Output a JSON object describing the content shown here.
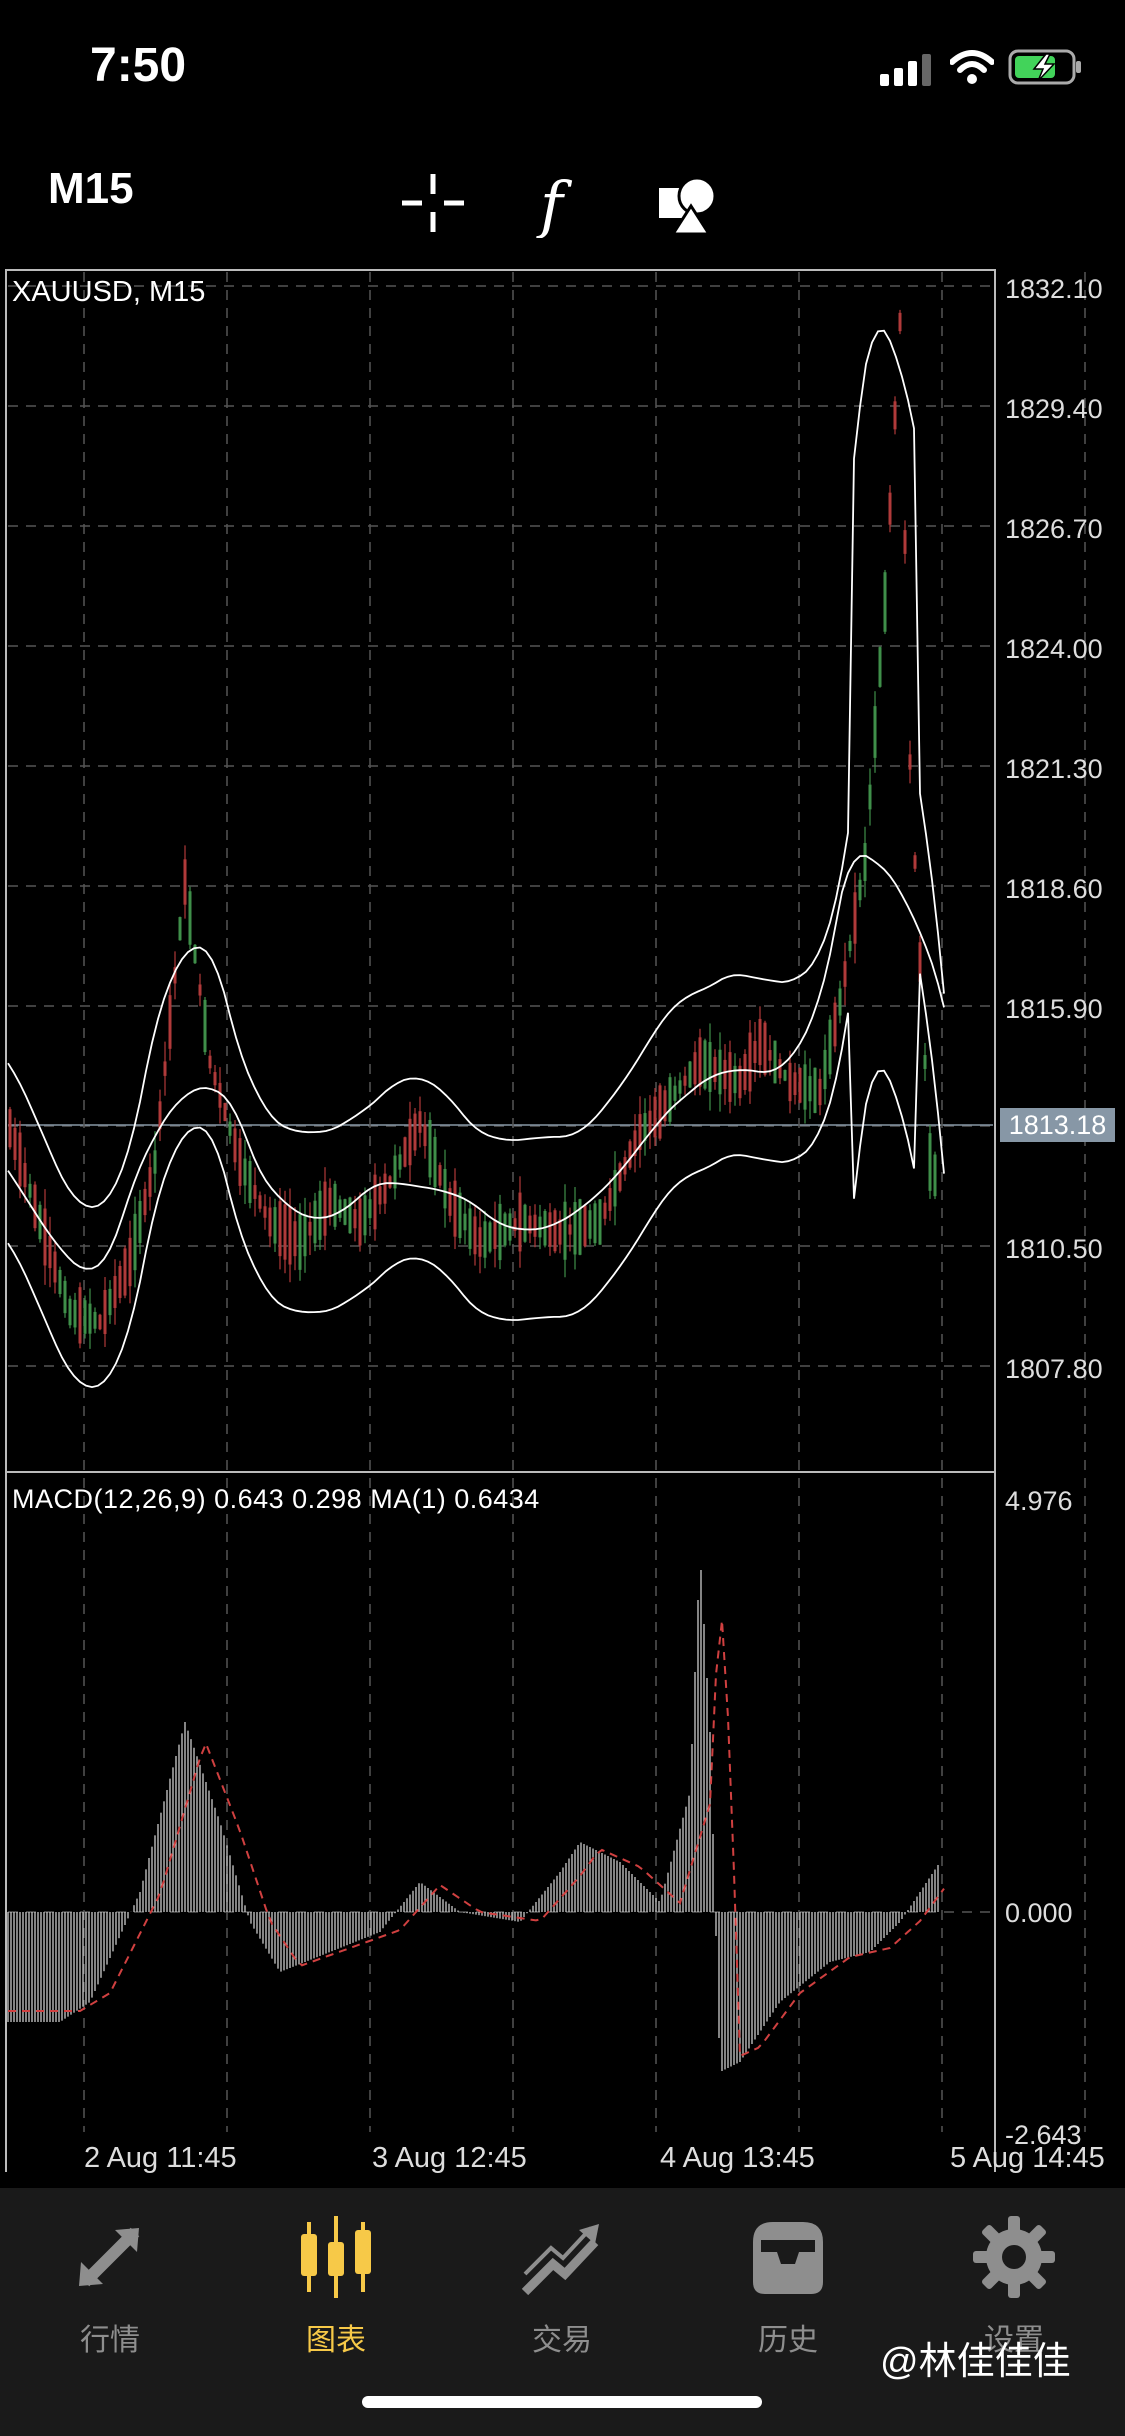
{
  "status": {
    "time": "7:50"
  },
  "toolbar": {
    "timeframe": "M15"
  },
  "chart": {
    "symbol_label": "XAUUSD, M15",
    "price_ticks": [
      "1832.10",
      "1829.40",
      "1826.70",
      "1824.00",
      "1821.30",
      "1818.60",
      "1815.90",
      "1810.50",
      "1807.80"
    ],
    "current_price": "1813.18",
    "macd_label": "MACD(12,26,9) 0.643 0.298 MA(1) 0.6434",
    "macd_ticks": [
      "4.976",
      "0.000",
      "-2.643"
    ],
    "x_labels": [
      "2 Aug 11:45",
      "3 Aug 12:45",
      "4 Aug 13:45",
      "5 Aug 14:45"
    ],
    "colors": {
      "bull": "#3f8f4a",
      "bear": "#b03a3a",
      "band": "#ffffff",
      "grid": "#555555"
    }
  },
  "tabs": [
    {
      "label": "行情",
      "icon": "quotes-arrows-icon"
    },
    {
      "label": "图表",
      "icon": "candlestick-chart-icon",
      "active": true
    },
    {
      "label": "交易",
      "icon": "trade-trend-icon"
    },
    {
      "label": "历史",
      "icon": "history-tray-icon"
    },
    {
      "label": "设置",
      "icon": "settings-gear-icon"
    }
  ],
  "watermark": "@林佳佳佳"
}
